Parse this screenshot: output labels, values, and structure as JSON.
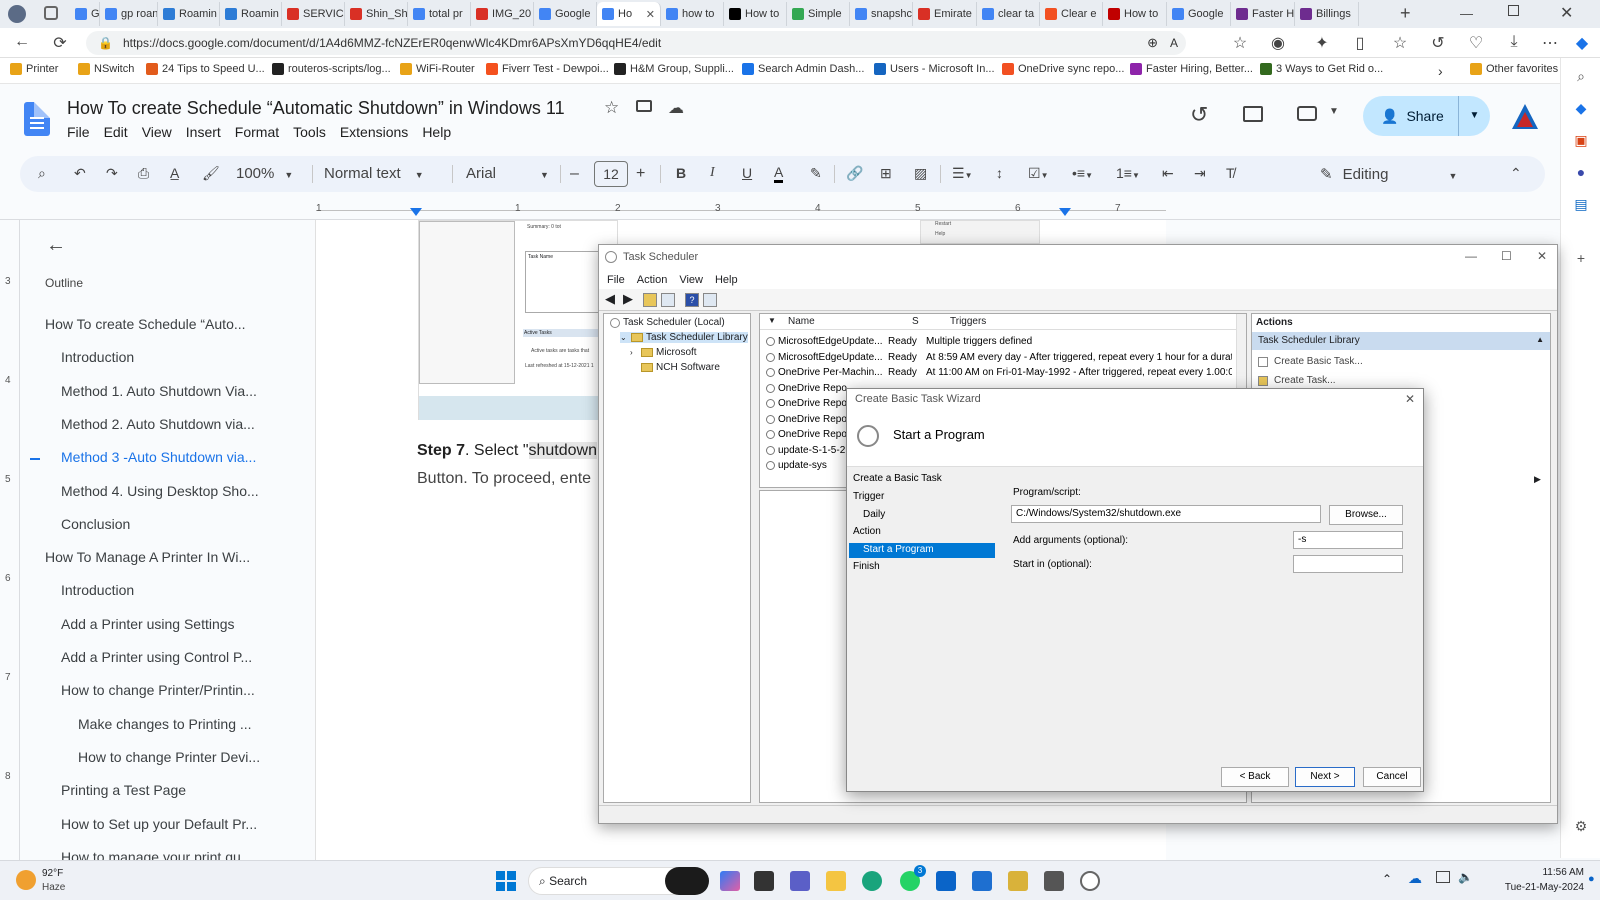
{
  "tabs": [
    {
      "label": "Google",
      "color": "#4285f4"
    },
    {
      "label": "gp roan",
      "color": "#4285f4"
    },
    {
      "label": "Roamin",
      "color": "#2d7cd6"
    },
    {
      "label": "Roamin",
      "color": "#2d7cd6"
    },
    {
      "label": "SERVIC",
      "color": "#d93025"
    },
    {
      "label": "Shin_Sh",
      "color": "#d93025"
    },
    {
      "label": "total pr",
      "color": "#4285f4"
    },
    {
      "label": "IMG_20",
      "color": "#d93025"
    },
    {
      "label": "Google",
      "color": "#4285f4"
    },
    {
      "label": "Ho",
      "color": "#4285f4"
    },
    {
      "label": "how to",
      "color": "#4285f4"
    },
    {
      "label": "How to",
      "color": "#000000"
    },
    {
      "label": "Simple",
      "color": "#34a853"
    },
    {
      "label": "snapshc",
      "color": "#4285f4"
    },
    {
      "label": "Emirate",
      "color": "#d93025"
    },
    {
      "label": "clear ta",
      "color": "#4285f4"
    },
    {
      "label": "Clear e",
      "color": "#f25022"
    },
    {
      "label": "How to",
      "color": "#c00000"
    },
    {
      "label": "Google",
      "color": "#4285f4"
    },
    {
      "label": "Faster H",
      "color": "#6e2c8f"
    },
    {
      "label": "Billings",
      "color": "#6e2c8f"
    }
  ],
  "url": "https://docs.google.com/document/d/1A4d6MMZ-fcNZErER0qenwWlc4KDmr6APsXmYD6qqHE4/edit",
  "bookmarks": [
    {
      "label": "Printer",
      "color": "#e8a317"
    },
    {
      "label": "NSwitch",
      "color": "#e8a317"
    },
    {
      "label": "24 Tips to Speed U...",
      "color": "#e25b1c"
    },
    {
      "label": "routeros-scripts/log...",
      "color": "#222222"
    },
    {
      "label": "WiFi-Router",
      "color": "#e8a317"
    },
    {
      "label": "Fiverr Test - Dewpoi...",
      "color": "#f4511e"
    },
    {
      "label": "H&M Group, Suppli...",
      "color": "#222222"
    },
    {
      "label": "Search Admin Dash...",
      "color": "#1a73e8"
    },
    {
      "label": "Users - Microsoft In...",
      "color": "#1565c0"
    },
    {
      "label": "OneDrive sync repo...",
      "color": "#f25022"
    },
    {
      "label": "Faster Hiring, Better...",
      "color": "#8e24aa"
    },
    {
      "label": "3 Ways to Get Rid o...",
      "color": "#33691e"
    }
  ],
  "other_favorites": "Other favorites",
  "doc": {
    "title": "How To create Schedule “Automatic Shutdown” in Windows 11",
    "menus": [
      "File",
      "Edit",
      "View",
      "Insert",
      "Format",
      "Tools",
      "Extensions",
      "Help"
    ],
    "share_label": "Share"
  },
  "toolbar": {
    "zoom": "100%",
    "style": "Normal text",
    "font": "Arial",
    "size": "12",
    "mode": "Editing"
  },
  "ruler_labels": [
    "1",
    "1",
    "2",
    "3",
    "4",
    "5",
    "6",
    "7"
  ],
  "vruler_labels": [
    "3",
    "4",
    "5",
    "6",
    "7",
    "8"
  ],
  "outline": {
    "heading": "Outline",
    "items": [
      {
        "text": "How To create Schedule “Auto...",
        "level": 1
      },
      {
        "text": "Introduction",
        "level": 2
      },
      {
        "text": "Method 1. Auto Shutdown Via...",
        "level": 2
      },
      {
        "text": "Method 2. Auto Shutdown via...",
        "level": 2
      },
      {
        "text": "Method 3 -Auto Shutdown via...",
        "level": 2,
        "active": true
      },
      {
        "text": "Method 4. Using Desktop Sho...",
        "level": 2
      },
      {
        "text": "Conclusion",
        "level": 2
      },
      {
        "text": "How To Manage A Printer In Wi...",
        "level": 1
      },
      {
        "text": "Introduction",
        "level": 2
      },
      {
        "text": "Add a Printer using Settings",
        "level": 2
      },
      {
        "text": "Add a Printer using Control P...",
        "level": 2
      },
      {
        "text": "How to change Printer/Printin...",
        "level": 2
      },
      {
        "text": "Make changes to Printing ...",
        "level": 3
      },
      {
        "text": "How to change Printer Devi...",
        "level": 3
      },
      {
        "text": "Printing a Test Page",
        "level": 2
      },
      {
        "text": "How to Set up your Default Pr...",
        "level": 2
      },
      {
        "text": "How to manage your print qu...",
        "level": 2
      }
    ]
  },
  "page": {
    "step_bold": "Step 7",
    "step_text": ". Select \"",
    "step_highlight": "shutdown",
    "line2": "Button. To proceed, ente",
    "img_summary": "Summary: 0 tot",
    "img_taskname": "Task Name",
    "img_active": "Active Tasks",
    "img_active_note": "Active tasks are tasks that",
    "img_refreshed": "Last refreshed at 15-12-2021 1",
    "img_top1": "Restart",
    "img_top2": "Help"
  },
  "task_scheduler": {
    "title": "Task Scheduler",
    "menus": [
      "File",
      "Action",
      "View",
      "Help"
    ],
    "tree": [
      {
        "text": "Task Scheduler (Local)",
        "indent": 0
      },
      {
        "text": "Task Scheduler Library",
        "indent": 1,
        "selected": true
      },
      {
        "text": "Microsoft",
        "indent": 2
      },
      {
        "text": "NCH Software",
        "indent": 2
      }
    ],
    "columns": [
      "Name",
      "S",
      "Triggers"
    ],
    "rows": [
      {
        "name": "MicrosoftEdgeUpdate...",
        "status": "Ready",
        "trigger": "Multiple triggers defined"
      },
      {
        "name": "MicrosoftEdgeUpdate...",
        "status": "Ready",
        "trigger": "At 8:59 AM every day - After triggered, repeat every 1 hour for a duratio"
      },
      {
        "name": "OneDrive Per-Machin...",
        "status": "Ready",
        "trigger": "At 11:00 AM on Fri-01-May-1992 - After triggered, repeat every 1.00:00:"
      },
      {
        "name": "OneDrive Repo",
        "status": "",
        "trigger": ""
      },
      {
        "name": "OneDrive Repo",
        "status": "",
        "trigger": ""
      },
      {
        "name": "OneDrive Repo",
        "status": "",
        "trigger": ""
      },
      {
        "name": "OneDrive Repo",
        "status": "",
        "trigger": ""
      },
      {
        "name": "update-S-1-5-2",
        "status": "",
        "trigger": ""
      },
      {
        "name": "update-sys",
        "status": "",
        "trigger": ""
      }
    ],
    "actions_header": "Actions",
    "actions_section": "Task Scheduler Library",
    "actions": [
      "Create Basic Task...",
      "Create Task..."
    ]
  },
  "wizard": {
    "title": "Create Basic Task Wizard",
    "heading": "Start a Program",
    "steps": [
      {
        "text": "Create a Basic Task",
        "sub": false
      },
      {
        "text": "Trigger",
        "sub": false
      },
      {
        "text": "Daily",
        "sub": true
      },
      {
        "text": "Action",
        "sub": false
      },
      {
        "text": "Start a Program",
        "sub": true,
        "active": true
      },
      {
        "text": "Finish",
        "sub": false
      }
    ],
    "program_label": "Program/script:",
    "program_value": "C:/Windows/System32/shutdown.exe",
    "browse": "Browse...",
    "args_label": "Add arguments (optional):",
    "args_value": "-s",
    "start_label": "Start in (optional):",
    "start_value": "",
    "back": "< Back",
    "next": "Next >",
    "cancel": "Cancel"
  },
  "taskbar": {
    "temp": "92°F",
    "weather": "Haze",
    "search": "Search",
    "time": "11:56 AM",
    "date": "Tue-21-May-2024",
    "whatsapp_badge": "3"
  }
}
